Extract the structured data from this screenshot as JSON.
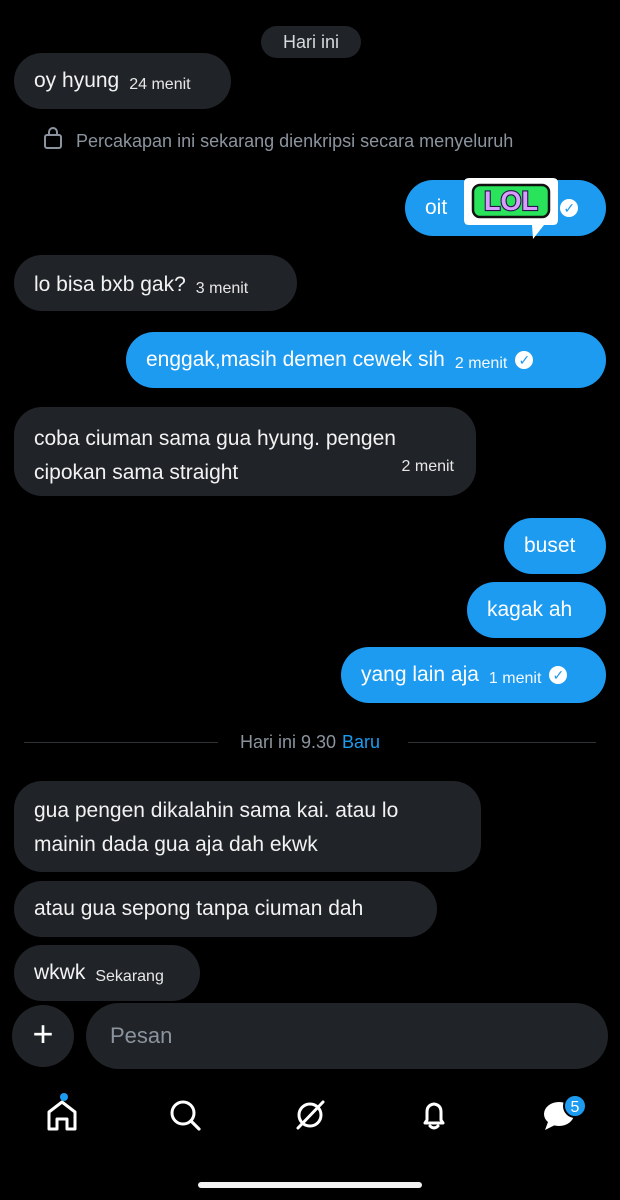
{
  "date_pill": "Hari ini",
  "messages": [
    {
      "text": "oy hyung",
      "time": "24 menit"
    },
    {
      "text": "Percakapan ini sekarang dienkripsi secara menyeluruh"
    },
    {
      "text": "oit",
      "reaction": "LOL"
    },
    {
      "text": "lo bisa bxb gak?",
      "time": "3 menit"
    },
    {
      "text": "enggak,masih demen cewek sih",
      "time": "2 menit"
    },
    {
      "text_line1": "coba ciuman sama gua hyung. pengen",
      "text_line2": "cipokan sama straight",
      "time": "2 menit"
    },
    {
      "text": "buset"
    },
    {
      "text": "kagak ah"
    },
    {
      "text": "yang lain aja",
      "time": "1 menit"
    },
    {
      "text_line1": "gua pengen dikalahin sama kai. atau lo",
      "text_line2": "mainin dada gua aja dah ekwk"
    },
    {
      "text": "atau gua sepong tanpa ciuman dah"
    },
    {
      "text": "wkwk",
      "time": "Sekarang"
    }
  ],
  "divider": {
    "time": "Hari ini 9.30",
    "new": "Baru"
  },
  "composer": {
    "plus": "+",
    "placeholder": "Pesan"
  },
  "nav": {
    "items": [
      {
        "icon": "home-icon"
      },
      {
        "icon": "search-icon"
      },
      {
        "icon": "grok-icon"
      },
      {
        "icon": "notifications-bell-icon"
      },
      {
        "icon": "messages-icon"
      }
    ],
    "messages_badge": "5"
  },
  "colors": {
    "background": "#000000",
    "incoming_bubble": "#202327",
    "outgoing_bubble": "#1d9bf0",
    "muted_text": "#8b949e"
  }
}
